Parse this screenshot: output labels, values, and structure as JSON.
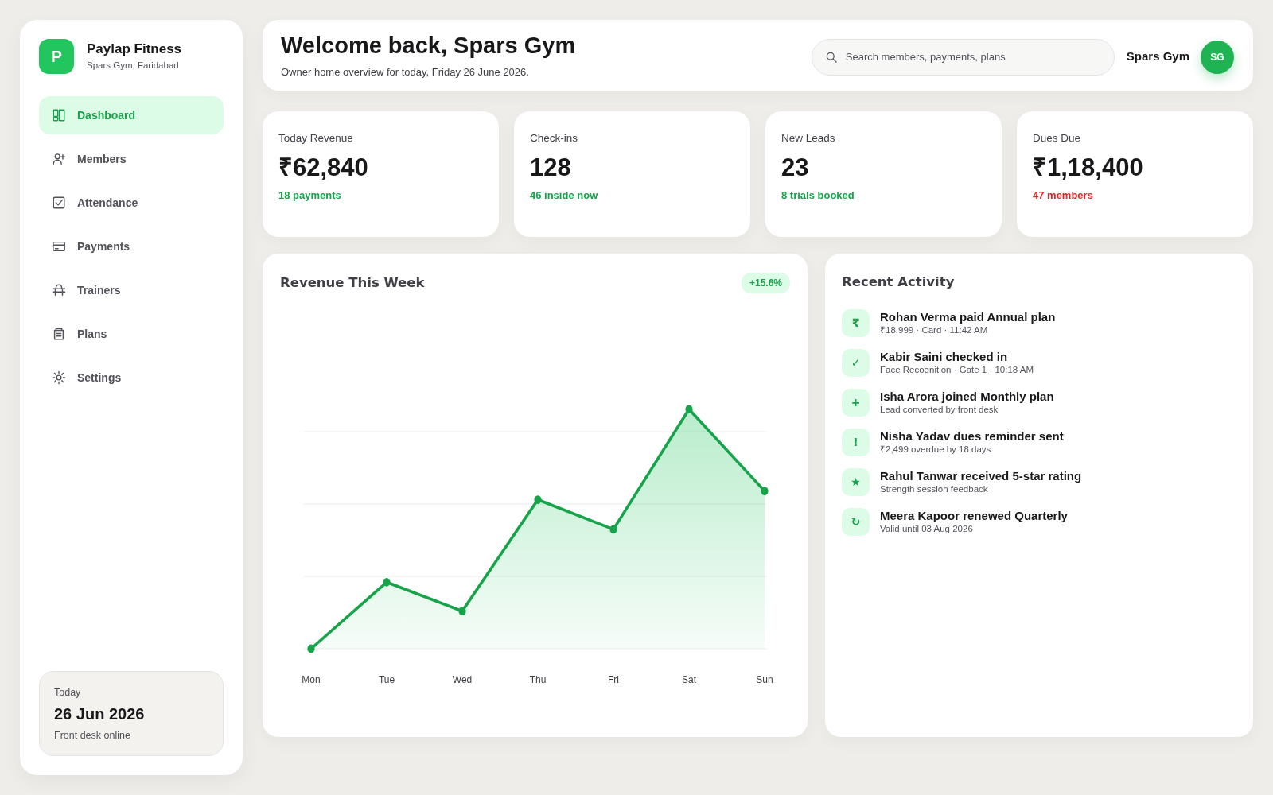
{
  "brand": {
    "logo_letter": "P",
    "name": "Paylap Fitness",
    "location": "Spars Gym, Faridabad"
  },
  "nav": [
    {
      "label": "Dashboard",
      "selected": true
    },
    {
      "label": "Members",
      "selected": false
    },
    {
      "label": "Attendance",
      "selected": false
    },
    {
      "label": "Payments",
      "selected": false
    },
    {
      "label": "Trainers",
      "selected": false
    },
    {
      "label": "Plans",
      "selected": false
    },
    {
      "label": "Settings",
      "selected": false
    }
  ],
  "today_card": {
    "label": "Today",
    "date": "26 Jun 2026",
    "status": "Front desk online"
  },
  "header": {
    "title": "Welcome back, Spars Gym",
    "subtitle": "Owner home overview for today, Friday 26 June 2026.",
    "search": {
      "placeholder": "Search members, payments, plans"
    },
    "user_name": "Spars Gym",
    "avatar_initials": "SG"
  },
  "stats": [
    {
      "label": "Today Revenue",
      "value": "₹62,840",
      "note": "18 payments",
      "color": "#16a34a"
    },
    {
      "label": "Check-ins",
      "value": "128",
      "note": "46 inside now",
      "color": "#16a34a"
    },
    {
      "label": "New Leads",
      "value": "23",
      "note": "8 trials booked",
      "color": "#16a34a"
    },
    {
      "label": "Dues Due",
      "value": "₹1,18,400",
      "note": "47 members",
      "color": "#dc2626"
    }
  ],
  "revenue_chart": {
    "title": "Revenue This Week",
    "change": "+15.6%",
    "x_labels": [
      "Mon",
      "Tue",
      "Wed",
      "Thu",
      "Fri",
      "Sat",
      "Sun"
    ]
  },
  "activity": {
    "title": "Recent Activity",
    "items": [
      {
        "symbol": "₹",
        "title": "Rohan Verma paid Annual plan",
        "detail": "₹18,999 · Card · 11:42 AM"
      },
      {
        "symbol": "✓",
        "title": "Kabir Saini checked in",
        "detail": "Face Recognition · Gate 1 · 10:18 AM"
      },
      {
        "symbol": "+",
        "title": "Isha Arora joined Monthly plan",
        "detail": "Lead converted by front desk"
      },
      {
        "symbol": "!",
        "title": "Nisha Yadav dues reminder sent",
        "detail": "₹2,499 overdue by 18 days"
      },
      {
        "symbol": "★",
        "title": "Rahul Tanwar received 5-star rating",
        "detail": "Strength session feedback"
      },
      {
        "symbol": "↻",
        "title": "Meera Kapoor renewed Quarterly",
        "detail": "Valid until 03 Aug 2026"
      }
    ]
  }
}
